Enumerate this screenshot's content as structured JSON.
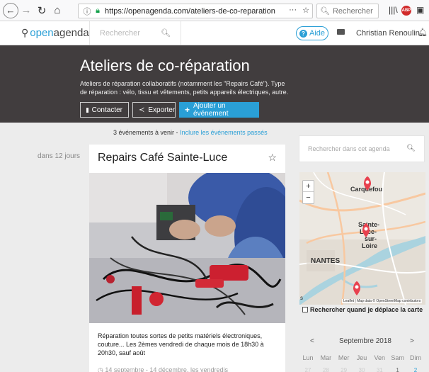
{
  "browser": {
    "url": "https://openagenda.com/ateliers-de-co-reparation",
    "url_menu": "···",
    "search_placeholder": "Rechercher"
  },
  "site": {
    "logo_open": "open",
    "logo_agenda": "agenda",
    "search_placeholder": "Rechercher",
    "help_label": "Aide",
    "user_name": "Christian Renoulin"
  },
  "banner": {
    "title": "Ateliers de co-réparation",
    "description": "Ateliers de réparation collaboratifs (notamment les \"Repairs Café\"). Type de réparation : vélo, tissu et vêtements, petits appareils électriques, autre.",
    "contact_label": "Contacter",
    "export_label": "Exporter",
    "add_event_label": "Ajouter un événement"
  },
  "events": {
    "count_text": "3 événements à venir - ",
    "include_past_label": "Inclure les événements passés",
    "date_label": "dans 12 jours"
  },
  "event_card": {
    "title": "Repairs Café Sainte-Luce",
    "description": "Réparation toutes sortes de petits matériels électroniques, couture... Les 2èmes vendredi de chaque mois de 18h30 à 20h30, sauf août",
    "dates": "14 septembre - 14 décembre, les vendredis"
  },
  "sidebar": {
    "search_placeholder": "Rechercher dans cet agenda",
    "map": {
      "labels": {
        "carquefou": "Carquefou",
        "sainte": "Sainte-",
        "luce": "Luce-",
        "sur": "sur-",
        "loire": "Loire",
        "nantes": "NANTES",
        "edge_s": "s"
      },
      "zoom_in": "+",
      "zoom_out": "−",
      "attribution": "Leaflet | Map data © OpenStreetMap contributors",
      "move_search_label": "Rechercher quand je déplace la carte"
    },
    "calendar": {
      "prev": "<",
      "next": ">",
      "month": "Septembre 2018",
      "days": [
        "Lun",
        "Mar",
        "Mer",
        "Jeu",
        "Ven",
        "Sam",
        "Dim"
      ],
      "numbers": [
        "27",
        "28",
        "29",
        "30",
        "31",
        "1",
        "2"
      ]
    }
  },
  "colors": {
    "accent": "#2a9fd6",
    "banner_bg": "#413d3e",
    "marker": "#e8414e"
  }
}
